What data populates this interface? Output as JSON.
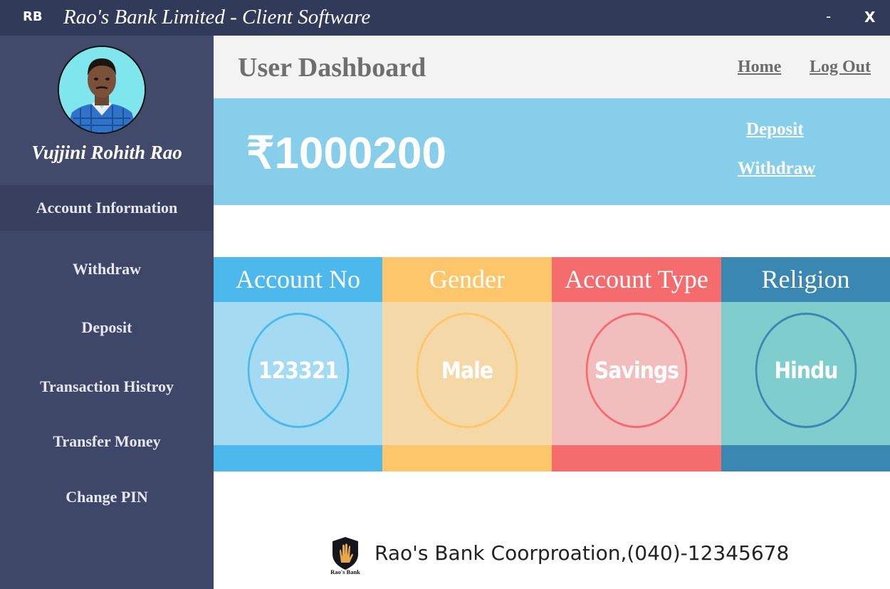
{
  "window": {
    "logo_text": "RB",
    "title": "Rao's Bank Limited - Client Software",
    "minimize_label": "-",
    "close_label": "X"
  },
  "sidebar": {
    "user_name": "Vujjini Rohith Rao",
    "items": [
      {
        "label": "Account Information",
        "active": true
      },
      {
        "label": "Withdraw"
      },
      {
        "label": "Deposit"
      },
      {
        "label": "Transaction Histroy"
      },
      {
        "label": "Transfer Money"
      },
      {
        "label": "Change PIN"
      }
    ]
  },
  "header": {
    "title": "User Dashboard",
    "home_link": "Home",
    "logout_link": "Log Out"
  },
  "balance": {
    "amount": "₹1000200",
    "deposit_link": "Deposit",
    "withdraw_link": "Withdraw"
  },
  "cards": [
    {
      "title": "Account No",
      "value": "123321",
      "colors": {
        "head": "#4db8ec",
        "body": "#a4dbf2",
        "ring": "#4db8ec"
      }
    },
    {
      "title": "Gender",
      "value": "Male",
      "colors": {
        "head": "#fdc66a",
        "body": "#f5d8a8",
        "ring": "#fdc66a"
      }
    },
    {
      "title": "Account Type",
      "value": "Savings",
      "colors": {
        "head": "#f46c6d",
        "body": "#f2bdbd",
        "ring": "#f46c6d"
      }
    },
    {
      "title": "Religion",
      "value": "Hindu",
      "colors": {
        "head": "#3a88b1",
        "body": "#7fcdcd",
        "ring": "#3a88b1"
      }
    }
  ],
  "footer": {
    "logo_caption": "Rao's Bank",
    "text": "Rao's Bank Coorproation,(040)-12345678"
  },
  "theme": {
    "titlebar": "#313a59",
    "sidebar": "#3f4768",
    "balance_panel": "#87ceea"
  }
}
